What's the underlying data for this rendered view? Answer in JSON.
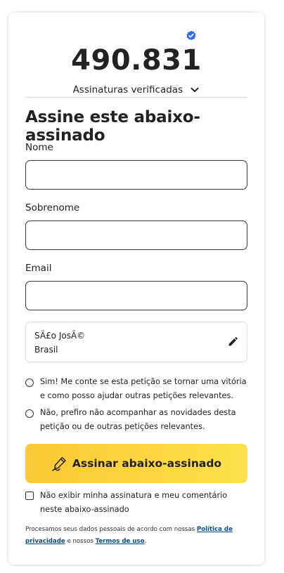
{
  "signatures": {
    "count": "490.831",
    "verified_label": "Assinaturas verificadas"
  },
  "form": {
    "title": "Assine este abaixo-assinado",
    "first_name_label": "Nome",
    "first_name_value": "",
    "last_name_label": "Sobrenome",
    "last_name_value": "",
    "email_label": "Email",
    "email_value": ""
  },
  "location": {
    "city": "SÃ£o JosÃ©",
    "country": "Brasil"
  },
  "options": {
    "opt_in": "Sim! Me conte se esta petição se tornar uma vitória e como posso ajudar outras petições relevantes.",
    "opt_out": "Não, prefiro não acompanhar as novidades desta petição ou de outras petições relevantes."
  },
  "sign_button_label": "Assinar abaixo-assinado",
  "hide_signature_label": "Não exibir minha assinatura e meu comentário neste abaixo-assinado",
  "footer": {
    "text_before": "Procesamos seus dados pessoais de acordo com nossas ",
    "privacy_link": "Política de privacidade",
    "text_middle": " e nossos ",
    "terms_link": "Termos de uso",
    "text_after": "."
  },
  "colors": {
    "verified_badge": "#2f6fe6",
    "button_gradient_start": "#fbc935",
    "button_gradient_end": "#fde04b",
    "link": "#0a4d8c"
  },
  "icons": {
    "verified": "verified-badge-icon",
    "expand": "chevron-down-icon",
    "edit": "pencil-icon",
    "sign": "pen-icon"
  }
}
